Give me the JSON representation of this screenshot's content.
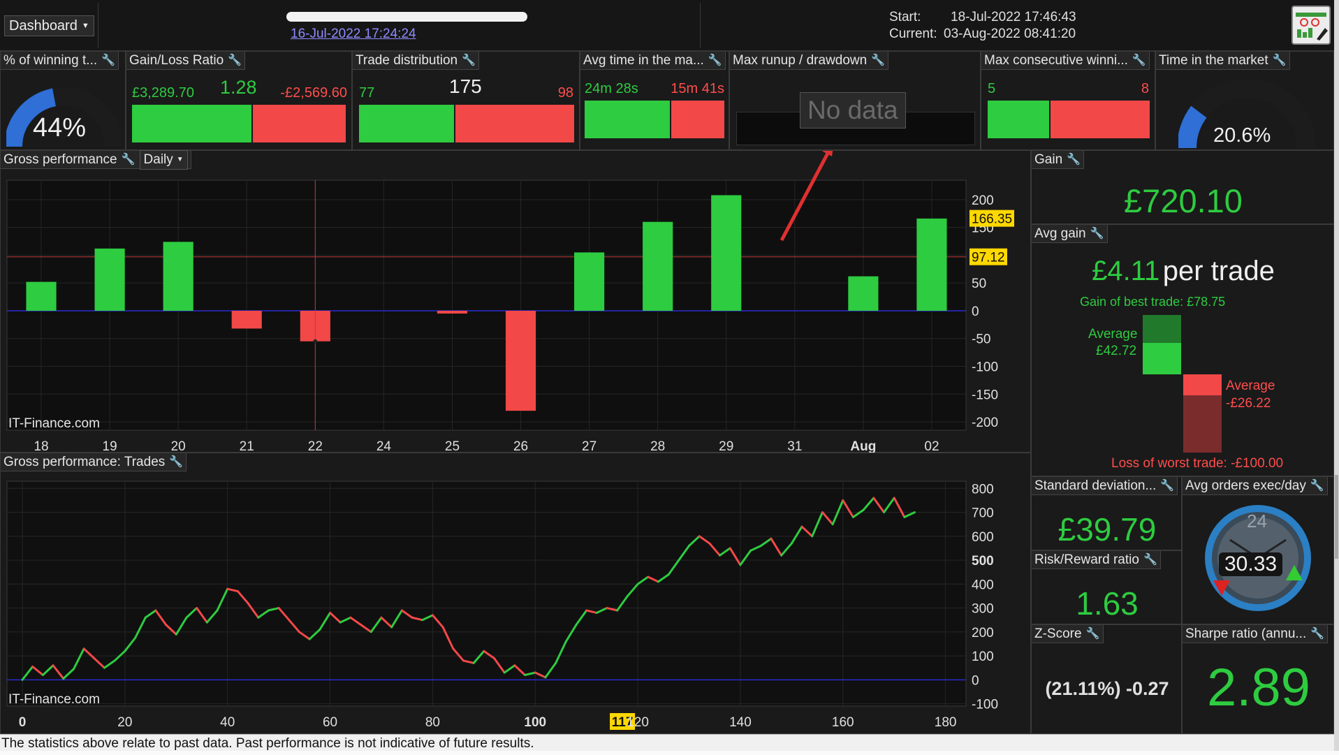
{
  "header": {
    "dashboard_label": "Dashboard",
    "date_link": "16-Jul-2022 17:24:24",
    "start_label": "Start:",
    "start_value": "18-Jul-2022 17:46:43",
    "current_label": "Current:",
    "current_value": "03-Aug-2022 08:41:20"
  },
  "widgets": {
    "winning": {
      "title": "% of winning t...",
      "value": "44%",
      "fraction": 0.44
    },
    "gainloss": {
      "title": "Gain/Loss Ratio",
      "gain": "£3,289.70",
      "ratio": "1.28",
      "loss": "-£2,569.60",
      "gain_fraction": 0.56
    },
    "trade_dist": {
      "title": "Trade distribution",
      "wins": "77",
      "total": "175",
      "losses": "98",
      "win_fraction": 0.44
    },
    "avg_time": {
      "title": "Avg time in the ma...",
      "win_time": "24m 28s",
      "loss_time": "15m 41s",
      "win_fraction": 0.61
    },
    "max_runup": {
      "title": "Max runup / drawdown",
      "no_data": "No data"
    },
    "max_consec": {
      "title": "Max consecutive winni...",
      "wins": "5",
      "losses": "8",
      "win_fraction": 0.38
    },
    "time_market": {
      "title": "Time in the market",
      "value": "20.6%",
      "fraction": 0.206
    }
  },
  "gross_daily": {
    "title": "Gross performance",
    "period": "Daily",
    "watermark": "IT-Finance.com",
    "label_high": "166.35",
    "label_mid": "97.12"
  },
  "gross_trades": {
    "title": "Gross performance: Trades",
    "watermark": "IT-Finance.com",
    "cursor_label": "117"
  },
  "gain": {
    "title": "Gain",
    "value": "£720.10"
  },
  "avg_gain": {
    "title": "Avg gain",
    "value": "£4.11",
    "suffix": "per trade",
    "best_trade": "Gain of best trade: £78.75",
    "avg_win_label": "Average",
    "avg_win_value": "£42.72",
    "avg_loss_label": "Average",
    "avg_loss_value": "-£26.22",
    "worst_trade": "Loss of worst trade: -£100.00"
  },
  "std_dev": {
    "title": "Standard deviation...",
    "value": "£39.79"
  },
  "avg_orders": {
    "title": "Avg orders exec/day",
    "dial_max": "24",
    "value": "30.33"
  },
  "risk_reward": {
    "title": "Risk/Reward ratio",
    "value": "1.63"
  },
  "zscore": {
    "title": "Z-Score",
    "value": "(21.11%) -0.27"
  },
  "sharpe": {
    "title": "Sharpe ratio (annu...",
    "value": "2.89"
  },
  "footer": {
    "disclaimer": "The statistics above relate to past data. Past performance is not indicative of future results."
  },
  "colors": {
    "green": "#2ecc40",
    "red": "#f24848",
    "background": "#0a0a0a"
  },
  "chart_data": [
    {
      "type": "bar",
      "title": "Gross performance",
      "categories": [
        "18",
        "19",
        "20",
        "21",
        "22",
        "24",
        "25",
        "26",
        "27",
        "28",
        "29",
        "31",
        "Aug",
        "02"
      ],
      "values": [
        52,
        112,
        124,
        -32,
        -55,
        0,
        -5,
        -180,
        105,
        160,
        208,
        0,
        62,
        166
      ],
      "y_ticks": [
        200,
        150,
        100,
        50,
        0,
        -50,
        -100,
        -150,
        -200
      ],
      "y_tick_labels": [
        "200",
        "150",
        "100",
        "50",
        "0",
        "-50",
        "-100",
        "-150",
        "-200"
      ],
      "ylim": [
        -215,
        235
      ],
      "ref_line": 97.12,
      "cursor_category": "22",
      "grid": true
    },
    {
      "type": "line",
      "title": "Gross performance: Trades",
      "x": [
        0,
        2,
        4,
        6,
        8,
        10,
        12,
        14,
        16,
        18,
        20,
        22,
        24,
        26,
        28,
        30,
        32,
        34,
        36,
        38,
        40,
        42,
        44,
        46,
        48,
        50,
        52,
        54,
        56,
        58,
        60,
        62,
        64,
        66,
        68,
        70,
        72,
        74,
        76,
        78,
        80,
        82,
        84,
        86,
        88,
        90,
        92,
        94,
        96,
        98,
        100,
        102,
        104,
        106,
        108,
        110,
        112,
        114,
        116,
        118,
        120,
        122,
        124,
        126,
        128,
        130,
        132,
        134,
        136,
        138,
        140,
        142,
        144,
        146,
        148,
        150,
        152,
        154,
        156,
        158,
        160,
        162,
        164,
        166,
        168,
        170,
        172,
        174
      ],
      "y": [
        0,
        55,
        20,
        60,
        5,
        45,
        130,
        90,
        50,
        80,
        120,
        175,
        260,
        290,
        230,
        190,
        260,
        300,
        240,
        290,
        380,
        370,
        320,
        260,
        290,
        300,
        250,
        200,
        170,
        210,
        280,
        240,
        260,
        230,
        200,
        260,
        220,
        290,
        260,
        250,
        270,
        220,
        130,
        80,
        70,
        120,
        90,
        30,
        60,
        20,
        30,
        10,
        70,
        160,
        230,
        290,
        280,
        300,
        290,
        350,
        400,
        430,
        410,
        440,
        500,
        560,
        600,
        570,
        520,
        550,
        480,
        540,
        560,
        590,
        520,
        570,
        640,
        600,
        700,
        650,
        750,
        680,
        710,
        760,
        700,
        760,
        680,
        700
      ],
      "x_ticks": [
        0,
        20,
        40,
        60,
        80,
        100,
        117,
        120,
        140,
        160,
        180
      ],
      "x_tick_labels": [
        "0",
        "20",
        "40",
        "60",
        "80",
        "100",
        "117",
        "120",
        "140",
        "160",
        "180"
      ],
      "y_ticks": [
        800,
        700,
        600,
        500,
        400,
        300,
        200,
        100,
        0,
        -100
      ],
      "y_tick_labels": [
        "800",
        "700",
        "600",
        "500",
        "400",
        "300",
        "200",
        "100",
        "0",
        "-100"
      ],
      "xlim": [
        -3,
        184
      ],
      "ylim": [
        -110,
        830
      ],
      "grid": true
    }
  ]
}
